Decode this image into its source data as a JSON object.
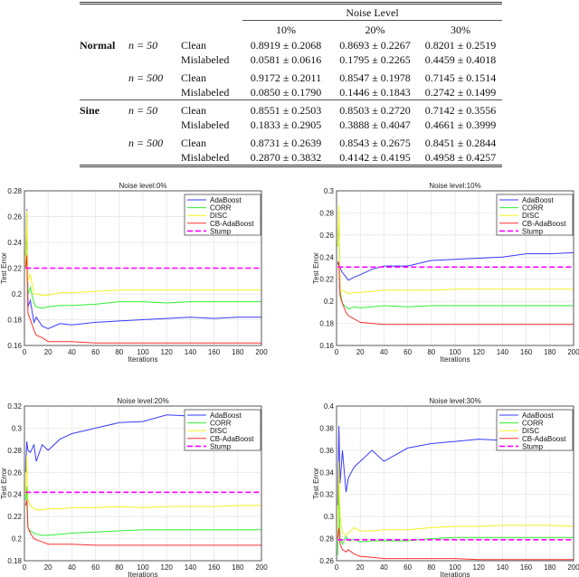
{
  "table": {
    "header": "Noise Level",
    "columns": [
      "10%",
      "20%",
      "30%"
    ],
    "rows": [
      {
        "dataset": "Normal",
        "n": "n = 50",
        "type": "Clean",
        "values": [
          "0.8919 ± 0.2068",
          "0.8693 ± 0.2267",
          "0.8201 ± 0.2519"
        ]
      },
      {
        "dataset": "",
        "n": "",
        "type": "Mislabeled",
        "values": [
          "0.0581 ± 0.0616",
          "0.1795 ± 0.2265",
          "0.4459 ± 0.4018"
        ]
      },
      {
        "dataset": "",
        "n": "n = 500",
        "type": "Clean",
        "values": [
          "0.9172 ± 0.2011",
          "0.8547 ± 0.1978",
          "0.7145 ± 0.1514"
        ]
      },
      {
        "dataset": "",
        "n": "",
        "type": "Mislabeled",
        "values": [
          "0.0850 ± 0.1790",
          "0.1446 ± 0.1843",
          "0.2742 ± 0.1499"
        ]
      },
      {
        "dataset": "Sine",
        "n": "n = 50",
        "type": "Clean",
        "values": [
          "0.8551 ± 0.2503",
          "0.8503 ± 0.2720",
          "0.7142 ± 0.3556"
        ]
      },
      {
        "dataset": "",
        "n": "",
        "type": "Mislabeled",
        "values": [
          "0.1833 ± 0.2905",
          "0.3888 ± 0.4047",
          "0.4661 ± 0.3999"
        ]
      },
      {
        "dataset": "",
        "n": "n = 500",
        "type": "Clean",
        "values": [
          "0.8731 ± 0.2639",
          "0.8543 ± 0.2675",
          "0.8451 ± 0.2844"
        ]
      },
      {
        "dataset": "",
        "n": "",
        "type": "Mislabeled",
        "values": [
          "0.2870 ± 0.3832",
          "0.4142 ± 0.4195",
          "0.4958 ± 0.4257"
        ]
      }
    ]
  },
  "colors": {
    "AdaBoost": "#3a3aff",
    "CORR": "#33ee33",
    "DISC": "#f2f222",
    "CB-AdaBoost": "#ff3030",
    "Stump": "#ff00ff"
  },
  "chart_data": [
    {
      "type": "line",
      "title": "Noise level:0%",
      "xlabel": "Iterations",
      "ylabel": "Test Error",
      "xlim": [
        0,
        200
      ],
      "ylim": [
        0.16,
        0.28
      ],
      "ystep": 0.02,
      "xticks": [
        0,
        20,
        40,
        60,
        80,
        100,
        120,
        140,
        160,
        180,
        200
      ],
      "grid": true,
      "legend": "top-right",
      "x": [
        1,
        2,
        3,
        5,
        8,
        10,
        15,
        20,
        30,
        40,
        60,
        80,
        100,
        120,
        140,
        160,
        180,
        200
      ],
      "series": [
        {
          "name": "AdaBoost",
          "values": [
            0.23,
            0.266,
            0.19,
            0.195,
            0.178,
            0.182,
            0.175,
            0.173,
            0.177,
            0.176,
            0.178,
            0.179,
            0.18,
            0.181,
            0.182,
            0.181,
            0.182,
            0.182
          ]
        },
        {
          "name": "CORR",
          "values": [
            0.23,
            0.25,
            0.2,
            0.205,
            0.193,
            0.19,
            0.189,
            0.19,
            0.191,
            0.191,
            0.192,
            0.194,
            0.194,
            0.193,
            0.194,
            0.194,
            0.194,
            0.194
          ]
        },
        {
          "name": "DISC",
          "values": [
            0.22,
            0.265,
            0.21,
            0.215,
            0.2,
            0.2,
            0.199,
            0.199,
            0.201,
            0.201,
            0.202,
            0.203,
            0.203,
            0.203,
            0.203,
            0.203,
            0.203,
            0.203
          ]
        },
        {
          "name": "CB-AdaBoost",
          "values": [
            0.22,
            0.23,
            0.185,
            0.18,
            0.172,
            0.168,
            0.166,
            0.163,
            0.163,
            0.163,
            0.162,
            0.162,
            0.162,
            0.162,
            0.162,
            0.162,
            0.162,
            0.162
          ]
        },
        {
          "name": "Stump",
          "dashed": true,
          "values": [
            0.22,
            0.22,
            0.22,
            0.22,
            0.22,
            0.22,
            0.22,
            0.22,
            0.22,
            0.22,
            0.22,
            0.22,
            0.22,
            0.22,
            0.22,
            0.22,
            0.22,
            0.22
          ]
        }
      ]
    },
    {
      "type": "line",
      "title": "Noise level:10%",
      "xlabel": "Iterations",
      "ylabel": "Test Error",
      "xlim": [
        0,
        200
      ],
      "ylim": [
        0.16,
        0.3
      ],
      "ystep": 0.02,
      "xticks": [
        0,
        20,
        40,
        60,
        80,
        100,
        120,
        140,
        160,
        180,
        200
      ],
      "grid": true,
      "legend": "top-right",
      "x": [
        1,
        2,
        3,
        5,
        8,
        10,
        15,
        20,
        30,
        40,
        60,
        80,
        100,
        120,
        140,
        160,
        180,
        200
      ],
      "series": [
        {
          "name": "AdaBoost",
          "values": [
            0.235,
            0.232,
            0.23,
            0.226,
            0.222,
            0.219,
            0.222,
            0.224,
            0.229,
            0.232,
            0.232,
            0.237,
            0.238,
            0.239,
            0.24,
            0.243,
            0.243,
            0.244
          ]
        },
        {
          "name": "CORR",
          "values": [
            0.25,
            0.275,
            0.21,
            0.198,
            0.195,
            0.193,
            0.195,
            0.194,
            0.195,
            0.196,
            0.195,
            0.196,
            0.196,
            0.196,
            0.196,
            0.196,
            0.196,
            0.196
          ]
        },
        {
          "name": "DISC",
          "values": [
            0.25,
            0.287,
            0.21,
            0.21,
            0.208,
            0.207,
            0.208,
            0.208,
            0.209,
            0.21,
            0.21,
            0.21,
            0.211,
            0.211,
            0.211,
            0.211,
            0.211,
            0.211
          ]
        },
        {
          "name": "CB-AdaBoost",
          "values": [
            0.236,
            0.235,
            0.205,
            0.198,
            0.19,
            0.187,
            0.184,
            0.181,
            0.18,
            0.179,
            0.179,
            0.179,
            0.179,
            0.179,
            0.179,
            0.179,
            0.179,
            0.179
          ]
        },
        {
          "name": "Stump",
          "dashed": true,
          "values": [
            0.231,
            0.231,
            0.231,
            0.231,
            0.231,
            0.231,
            0.231,
            0.231,
            0.231,
            0.231,
            0.231,
            0.231,
            0.231,
            0.231,
            0.231,
            0.231,
            0.231,
            0.231
          ]
        }
      ]
    },
    {
      "type": "line",
      "title": "Noise level:20%",
      "xlabel": "Iterations",
      "ylabel": "Test Error",
      "xlim": [
        0,
        200
      ],
      "ylim": [
        0.18,
        0.32
      ],
      "ystep": 0.02,
      "xticks": [
        0,
        20,
        40,
        60,
        80,
        100,
        120,
        140,
        160,
        180,
        200
      ],
      "grid": true,
      "legend": "top-right",
      "x": [
        1,
        2,
        3,
        5,
        8,
        10,
        15,
        20,
        30,
        40,
        60,
        80,
        100,
        120,
        140,
        160,
        180,
        200
      ],
      "series": [
        {
          "name": "AdaBoost",
          "values": [
            0.26,
            0.288,
            0.28,
            0.278,
            0.285,
            0.27,
            0.285,
            0.28,
            0.29,
            0.295,
            0.3,
            0.305,
            0.306,
            0.312,
            0.311,
            0.314,
            0.316,
            0.314
          ]
        },
        {
          "name": "CORR",
          "values": [
            0.235,
            0.247,
            0.21,
            0.207,
            0.205,
            0.204,
            0.203,
            0.203,
            0.204,
            0.205,
            0.206,
            0.207,
            0.208,
            0.208,
            0.208,
            0.208,
            0.208,
            0.208
          ]
        },
        {
          "name": "DISC",
          "values": [
            0.24,
            0.275,
            0.235,
            0.23,
            0.227,
            0.226,
            0.226,
            0.227,
            0.227,
            0.228,
            0.228,
            0.229,
            0.228,
            0.229,
            0.229,
            0.229,
            0.23,
            0.23
          ]
        },
        {
          "name": "CB-AdaBoost",
          "values": [
            0.23,
            0.235,
            0.21,
            0.205,
            0.2,
            0.199,
            0.197,
            0.195,
            0.195,
            0.195,
            0.194,
            0.194,
            0.194,
            0.194,
            0.194,
            0.194,
            0.194,
            0.194
          ]
        },
        {
          "name": "Stump",
          "dashed": true,
          "values": [
            0.242,
            0.242,
            0.242,
            0.242,
            0.242,
            0.242,
            0.242,
            0.242,
            0.242,
            0.242,
            0.242,
            0.242,
            0.242,
            0.242,
            0.242,
            0.242,
            0.242,
            0.242
          ]
        }
      ]
    },
    {
      "type": "line",
      "title": "Noise level:30%",
      "xlabel": "Iterations",
      "ylabel": "Test Error",
      "xlim": [
        0,
        200
      ],
      "ylim": [
        0.26,
        0.4
      ],
      "ystep": 0.02,
      "xticks": [
        0,
        20,
        40,
        60,
        80,
        100,
        120,
        140,
        160,
        180,
        200
      ],
      "grid": true,
      "legend": "top-right",
      "x": [
        1,
        2,
        3,
        5,
        8,
        10,
        15,
        20,
        30,
        40,
        60,
        80,
        100,
        120,
        140,
        160,
        180,
        200
      ],
      "series": [
        {
          "name": "AdaBoost",
          "values": [
            0.31,
            0.382,
            0.33,
            0.36,
            0.322,
            0.335,
            0.345,
            0.35,
            0.36,
            0.35,
            0.362,
            0.366,
            0.368,
            0.37,
            0.369,
            0.37,
            0.37,
            0.371
          ]
        },
        {
          "name": "CORR",
          "values": [
            0.265,
            0.33,
            0.28,
            0.275,
            0.282,
            0.278,
            0.279,
            0.277,
            0.278,
            0.278,
            0.278,
            0.28,
            0.281,
            0.281,
            0.281,
            0.281,
            0.281,
            0.281
          ]
        },
        {
          "name": "DISC",
          "values": [
            0.28,
            0.35,
            0.3,
            0.285,
            0.283,
            0.285,
            0.29,
            0.287,
            0.287,
            0.288,
            0.288,
            0.29,
            0.291,
            0.291,
            0.292,
            0.292,
            0.292,
            0.291
          ]
        },
        {
          "name": "CB-AdaBoost",
          "values": [
            0.28,
            0.29,
            0.275,
            0.27,
            0.268,
            0.27,
            0.266,
            0.264,
            0.263,
            0.262,
            0.262,
            0.262,
            0.262,
            0.261,
            0.261,
            0.261,
            0.261,
            0.261
          ]
        },
        {
          "name": "Stump",
          "dashed": true,
          "values": [
            0.279,
            0.279,
            0.279,
            0.279,
            0.279,
            0.279,
            0.279,
            0.279,
            0.279,
            0.279,
            0.279,
            0.279,
            0.279,
            0.279,
            0.279,
            0.279,
            0.279,
            0.279
          ]
        }
      ]
    }
  ]
}
